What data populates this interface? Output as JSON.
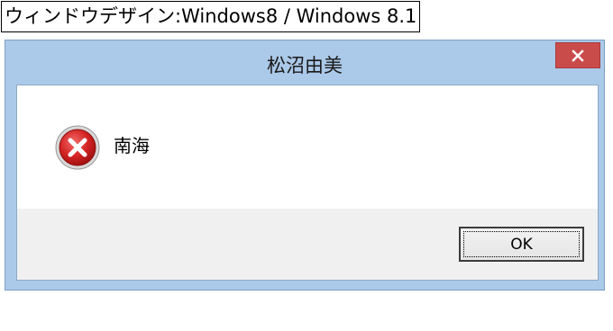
{
  "caption": "ウィンドウデザイン:Windows8 / Windows 8.1",
  "dialog": {
    "title": "松沼由美",
    "message": "南海",
    "ok_label": "OK",
    "icons": {
      "close": "close-icon",
      "error": "error-icon"
    }
  },
  "colors": {
    "frame": "#abc9e8",
    "close_button": "#c94c4b",
    "footer": "#f0f0f0",
    "error_red": "#d42424"
  }
}
